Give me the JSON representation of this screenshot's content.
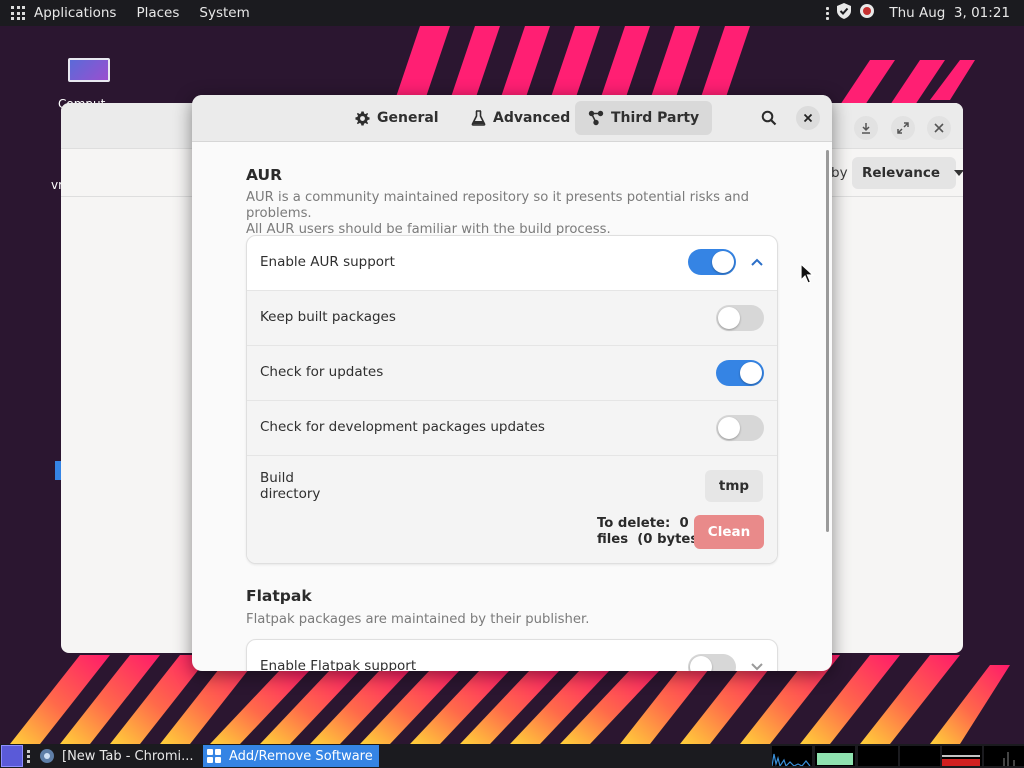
{
  "top_panel": {
    "menus": [
      "Applications",
      "Places",
      "System"
    ],
    "clock": "Thu Aug  3, 01:21"
  },
  "desktop": {
    "icon_label": "Comput",
    "left_text": "vr"
  },
  "background_window": {
    "sort_by_label": "by",
    "sort_value": "Relevance"
  },
  "dialog": {
    "tabs": [
      {
        "label": "General",
        "icon": "gear-icon",
        "active": false
      },
      {
        "label": "Advanced",
        "icon": "flask-icon",
        "active": false
      },
      {
        "label": "Third Party",
        "icon": "nodes-icon",
        "active": true
      }
    ],
    "search_icon": "search-icon",
    "close_icon": "close-icon",
    "aur": {
      "title": "AUR",
      "description": "AUR is a community maintained repository so it presents potential risks and problems.\nAll AUR users should be familiar with the build process.",
      "enable_label": "Enable AUR support",
      "enable_on": true,
      "keep_built_label": "Keep built packages",
      "keep_built_on": false,
      "check_updates_label": "Check for updates",
      "check_updates_on": true,
      "check_dev_label": "Check for development packages updates",
      "check_dev_on": false,
      "build_dir_label": "Build\ndirectory",
      "build_dir_value": "tmp",
      "to_delete_text": "To delete:  0\nfiles  (0 bytes)",
      "clean_label": "Clean"
    },
    "flatpak": {
      "title": "Flatpak",
      "description": "Flatpak packages are maintained by their publisher.",
      "enable_label": "Enable Flatpak support",
      "enable_on": false
    }
  },
  "taskbar": {
    "items": [
      "[New Tab - Chromi...",
      "Add/Remove Software"
    ]
  },
  "colors": {
    "accent": "#3584e4",
    "destructive": "#e98a8a",
    "panel": "#1b1b1f"
  }
}
